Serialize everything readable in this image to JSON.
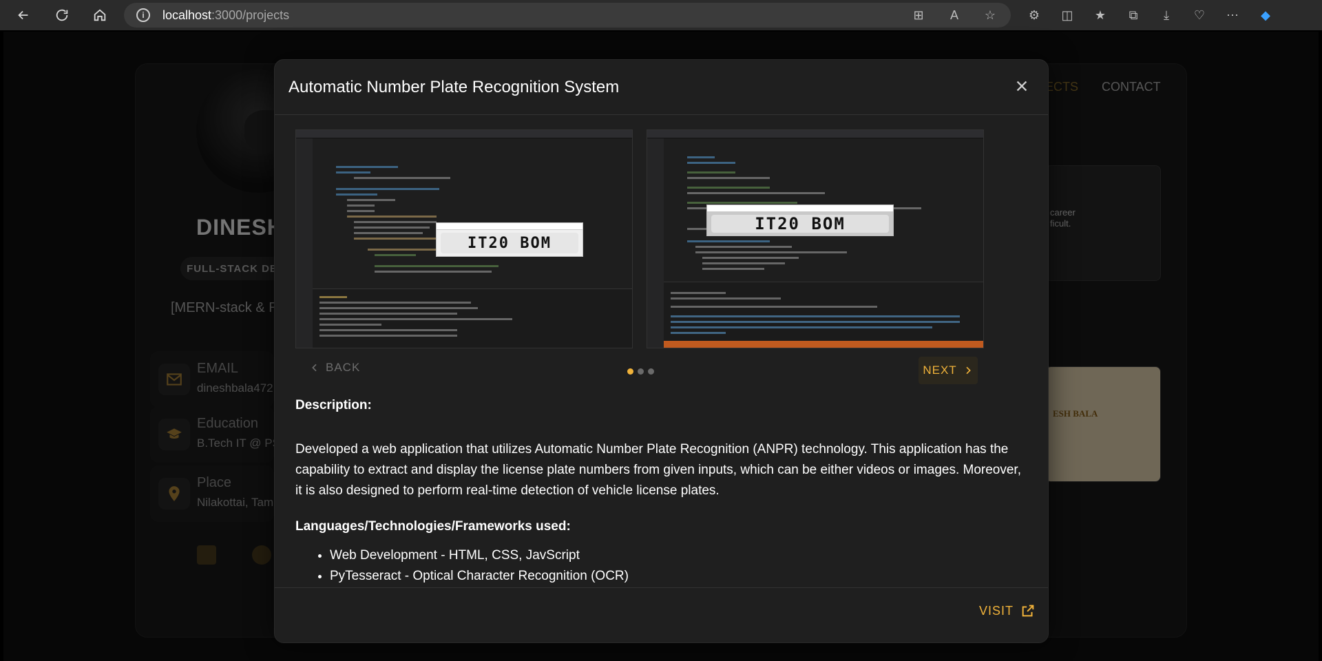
{
  "browser": {
    "url_host": "localhost",
    "url_path": ":3000/projects"
  },
  "background_page": {
    "name": "DINESH",
    "role": "FULL-STACK DE",
    "stack": "[MERN-stack & R",
    "nav": {
      "projects": "ECTS",
      "contact": "CONTACT"
    },
    "info_rows": [
      {
        "label": "EMAIL",
        "value": "dineshbala472",
        "icon": "mail-icon"
      },
      {
        "label": "Education",
        "value": "B.Tech IT @ PS",
        "icon": "graduation-cap-icon"
      },
      {
        "label": "Place",
        "value": "Nilakottai, Tam",
        "icon": "location-pin-icon"
      }
    ],
    "thumb_text": {
      "career": "career",
      "difficult": "ficult.",
      "bala": "ESH BALA"
    }
  },
  "modal": {
    "title": "Automatic Number Plate Recognition System",
    "plate_text": "IT20 BOM",
    "carousel": {
      "back_label": "BACK",
      "next_label": "NEXT",
      "slide_count": 3,
      "active_index": 0
    },
    "description_heading": "Description:",
    "description": "Developed a web application that utilizes Automatic Number Plate Recognition (ANPR) technology. This application has the capability to extract and display the license plate numbers from given inputs, which can be either videos or images. Moreover, it is also designed to perform real-time detection of vehicle license plates.",
    "technologies_heading": "Languages/Technologies/Frameworks used:",
    "technologies": [
      "Web Development - HTML, CSS, JavScript",
      "PyTesseract - Optical Character Recognition (OCR)"
    ],
    "visit_label": "VISIT"
  },
  "colors": {
    "accent": "#f0b23a",
    "modal_bg": "#1f1f1f",
    "page_bg": "#0c0c0c"
  }
}
